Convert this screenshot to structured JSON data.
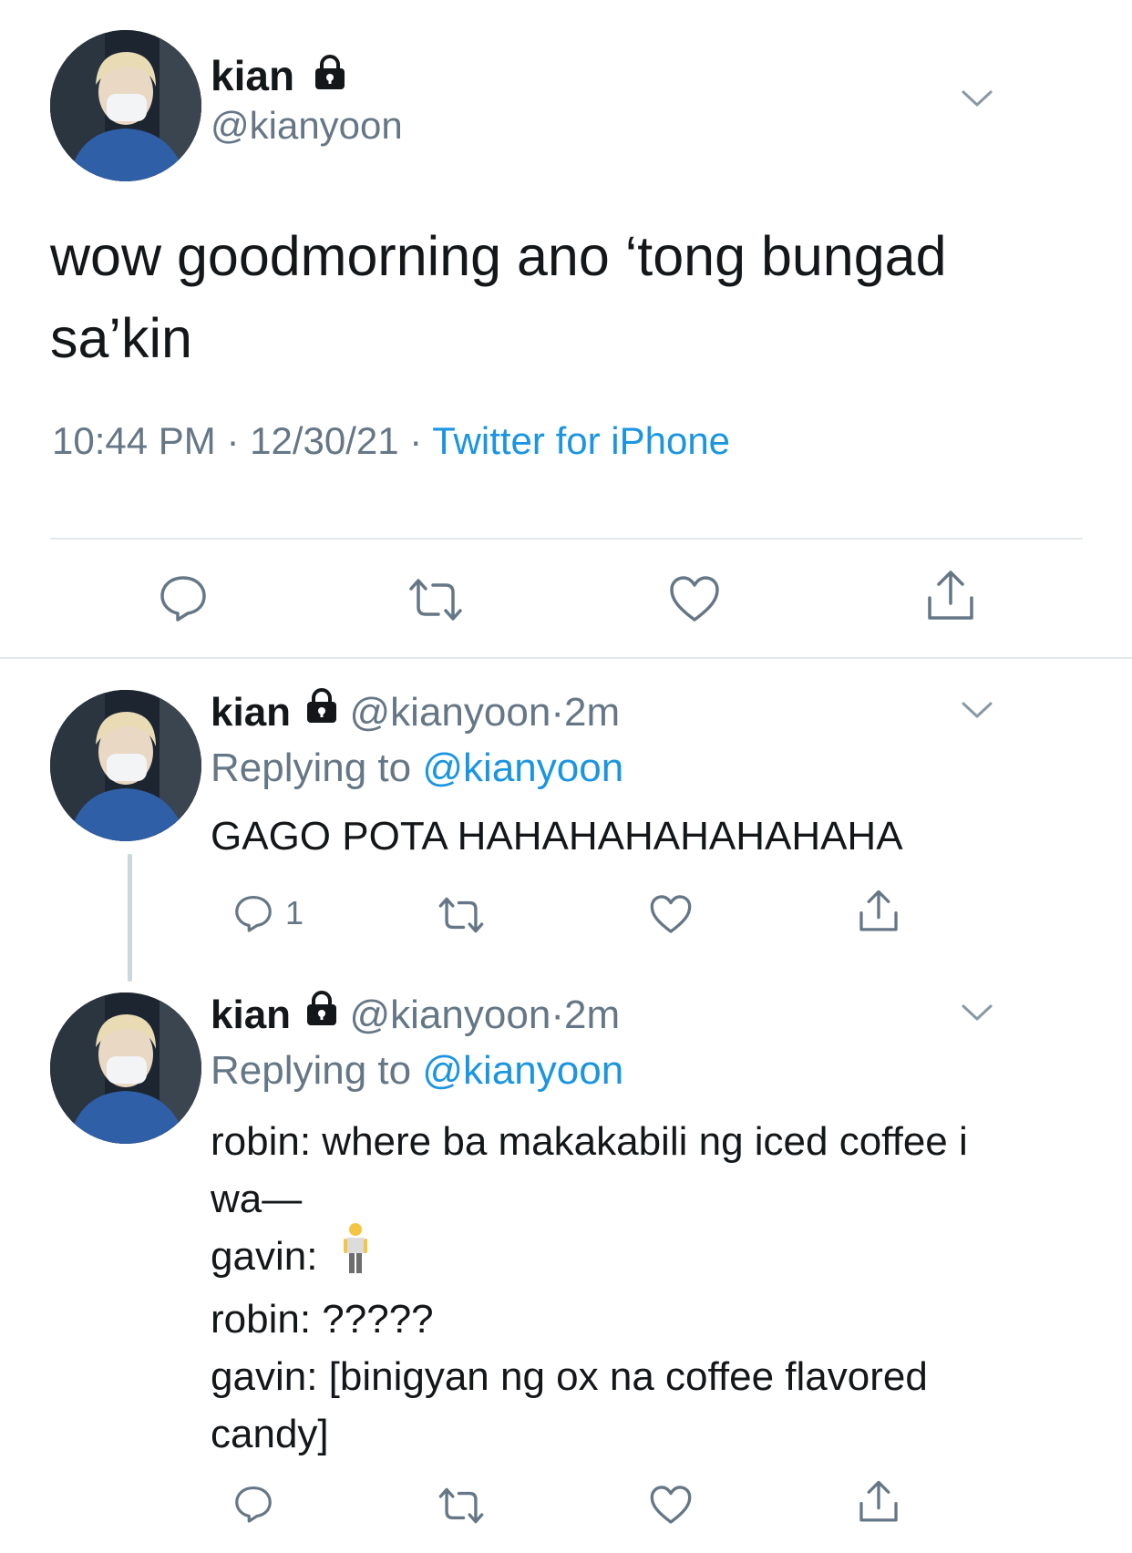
{
  "main_tweet": {
    "display_name": "kian",
    "handle": "@kianyoon",
    "text_lines": [
      "wow goodmorning ano ‘tong bungad",
      "sa’kin"
    ],
    "time": "10:44 PM",
    "date": "12/30/21",
    "separator": "·",
    "source": "Twitter for iPhone"
  },
  "replies": [
    {
      "display_name": "kian",
      "handle": "@kianyoon",
      "dot": "·",
      "age": "2m",
      "replying_label": "Replying to",
      "replying_handle": "@kianyoon",
      "text_lines": [
        "GAGO POTA HAHAHAHAHAHAHAHA"
      ],
      "reply_count": "1"
    },
    {
      "display_name": "kian",
      "handle": "@kianyoon",
      "dot": "·",
      "age": "2m",
      "replying_label": "Replying to",
      "replying_handle": "@kianyoon",
      "text_lines": [
        "robin: where ba makakabili ng iced coffee i",
        "wa—",
        "gavin: ",
        "robin: ?????",
        "gavin: [binigyan ng ox na coffee flavored",
        "candy]"
      ],
      "emoji_label": "standing person emoji"
    }
  ],
  "icons": {
    "reply": "reply-icon",
    "retweet": "retweet-icon",
    "like": "heart-icon",
    "share": "share-icon",
    "lock": "lock-icon",
    "chevron": "chevron-down-icon"
  },
  "colors": {
    "text": "#14171a",
    "secondary": "#657786",
    "link": "#1b95e0",
    "divider": "#e1e8ed",
    "thread_line": "#ccd6dd"
  }
}
